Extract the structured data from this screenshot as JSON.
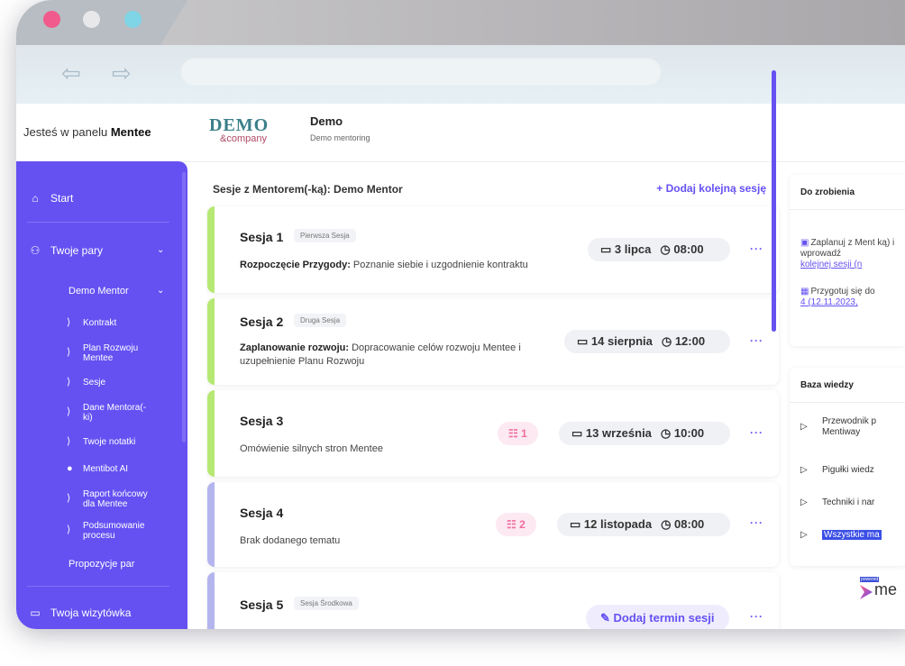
{
  "header": {
    "panel_prefix": "Jesteś w panelu ",
    "panel_role": "Mentee",
    "logo_main": "DEMO",
    "logo_sub": "&company",
    "title": "Demo",
    "subtitle": "Demo mentoring"
  },
  "sidebar": {
    "start": "Start",
    "pairs": "Twoje pary",
    "mentor": "Demo Mentor",
    "sub_items": [
      "Kontrakt",
      "Plan Rozwoju Mentee",
      "Sesje",
      "Dane Mentora(-ki)",
      "Twoje notatki",
      "Mentibot AI",
      "Raport końcowy dla Mentee",
      "Podsumowanie procesu"
    ],
    "proposals": "Propozycje par",
    "card": "Twoja wizytówka"
  },
  "main": {
    "title": "Sesje z Mentorem(-ką): Demo Mentor",
    "add_session": "+ Dodaj kolejną sesję",
    "sessions": [
      {
        "title": "Sesja 1",
        "tag": "Pierwsza Sesja",
        "desc_bold": "Rozpoczęcie Przygody:",
        "desc": " Poznanie siebie i uzgodnienie kontraktu",
        "date": "3 lipca",
        "time": "08:00",
        "badge": ""
      },
      {
        "title": "Sesja 2",
        "tag": "Druga Sesja",
        "desc_bold": "Zaplanowanie rozwoju:",
        "desc": " Dopracowanie celów rozwoju Mentee i uzupełnienie Planu Rozwoju",
        "date": "14 sierpnia",
        "time": "12:00",
        "badge": ""
      },
      {
        "title": "Sesja 3",
        "tag": "",
        "desc_bold": "",
        "desc": "Omówienie silnych stron Mentee",
        "date": "13 września",
        "time": "10:00",
        "badge": "1"
      },
      {
        "title": "Sesja 4",
        "tag": "",
        "desc_bold": "",
        "desc": "Brak dodanego tematu",
        "date": "12 listopada",
        "time": "08:00",
        "badge": "2"
      },
      {
        "title": "Sesja 5",
        "tag": "Sesja Środkowa",
        "desc_bold": "",
        "desc": "",
        "date": "",
        "time": "",
        "badge": "",
        "action": "Dodaj termin sesji"
      }
    ],
    "more": "···"
  },
  "todo": {
    "title": "Do zrobienia",
    "item1_text": "Zaplanuj z Ment ką) i wprowadź",
    "item1_link": "kolejnej sesji (n",
    "item2_text": "Przygotuj się do",
    "item2_link": "4 (12.11.2023,"
  },
  "knowledge": {
    "title": "Baza wiedzy",
    "items": [
      "Przewodnik p Mentiway",
      "Pigułki wiedz",
      "Techniki i nar",
      "Wszystkie ma"
    ]
  },
  "powered": {
    "label": "powered",
    "brand": "me"
  },
  "colors": {
    "accent": "#6551f2",
    "green": "#b6e874",
    "lavender": "#b4b5ee",
    "pink": "#f06da0"
  }
}
